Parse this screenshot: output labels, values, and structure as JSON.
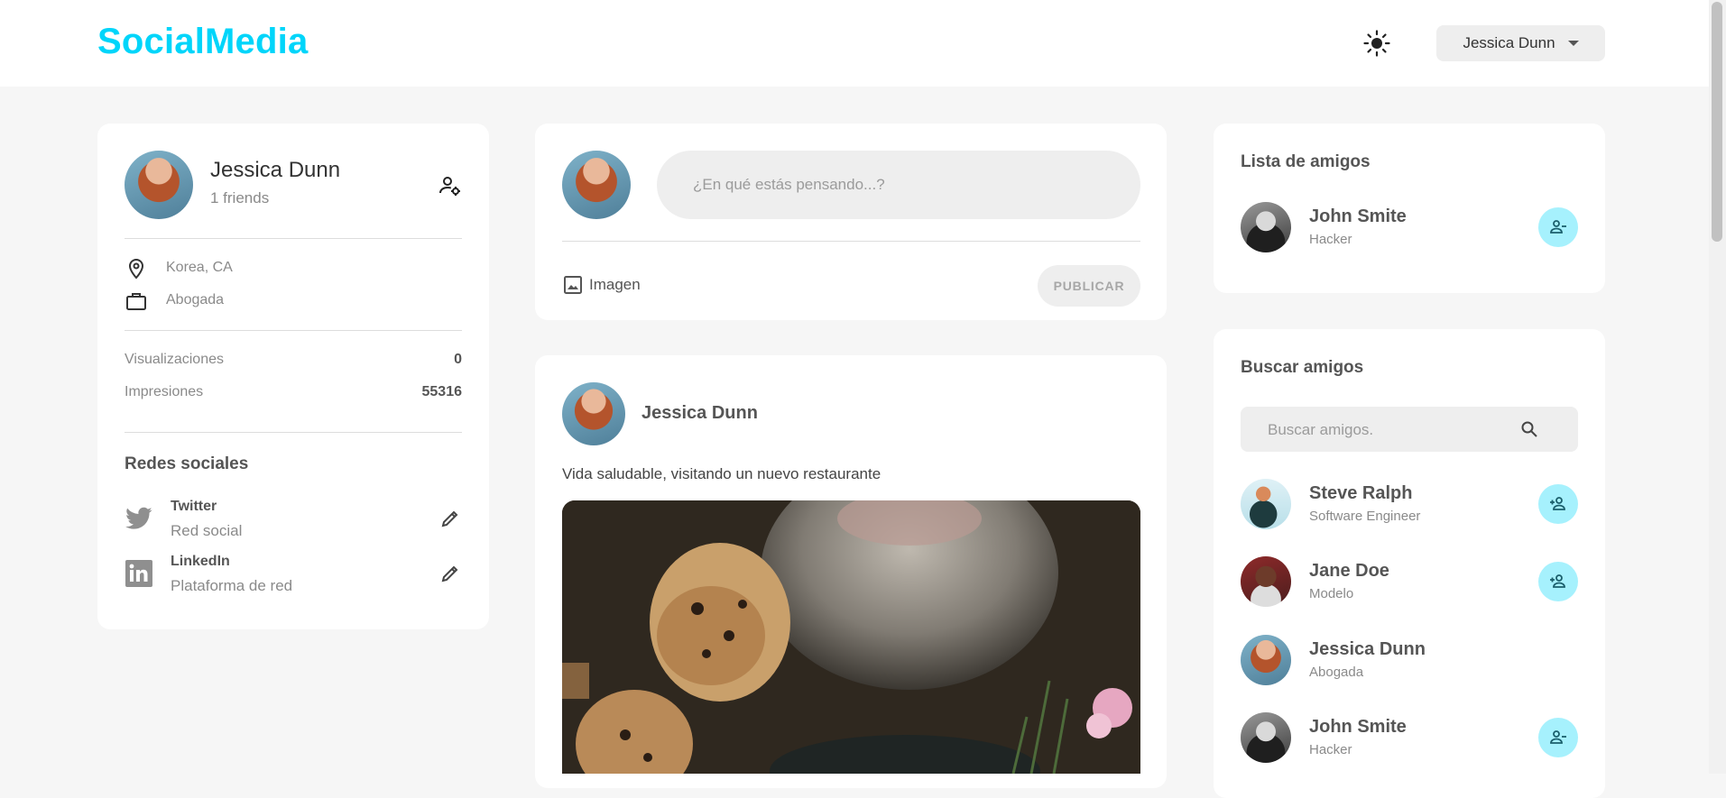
{
  "navbar": {
    "brand": "SocialMedia",
    "theme_icon": "sun-icon",
    "user_name": "Jessica Dunn"
  },
  "profile": {
    "name": "Jessica Dunn",
    "friends": "1 friends",
    "location": "Korea, CA",
    "occupation": "Abogada",
    "stats": [
      {
        "label": "Visualizaciones",
        "value": "0"
      },
      {
        "label": "Impresiones",
        "value": "55316"
      }
    ],
    "social_title": "Redes sociales",
    "social": [
      {
        "name": "Twitter",
        "type": "Red social",
        "icon": "twitter-icon"
      },
      {
        "name": "LinkedIn",
        "type": "Plataforma de red",
        "icon": "linkedin-icon"
      }
    ]
  },
  "composer": {
    "placeholder": "¿En qué estás pensando...?",
    "image_label": "Imagen",
    "publish_label": "PUBLICAR"
  },
  "post": {
    "author": "Jessica Dunn",
    "text": "Vida saludable, visitando un nuevo restaurante"
  },
  "friend_list": {
    "title": "Lista de amigos",
    "items": [
      {
        "name": "John Smite",
        "role": "Hacker",
        "action": "remove-friend-icon"
      }
    ]
  },
  "find_friends": {
    "title": "Buscar amigos",
    "search_placeholder": "Buscar amigos.",
    "items": [
      {
        "name": "Steve Ralph",
        "role": "Software Engineer",
        "action": "add-friend-icon"
      },
      {
        "name": "Jane Doe",
        "role": "Modelo",
        "action": "add-friend-icon"
      },
      {
        "name": "Jessica Dunn",
        "role": "Abogada",
        "action": ""
      },
      {
        "name": "John Smite",
        "role": "Hacker",
        "action": "remove-friend-icon"
      }
    ]
  },
  "colors": {
    "brand": "#00d5fa",
    "friend_button": "#a6f1fd",
    "background": "#f6f6f6"
  }
}
